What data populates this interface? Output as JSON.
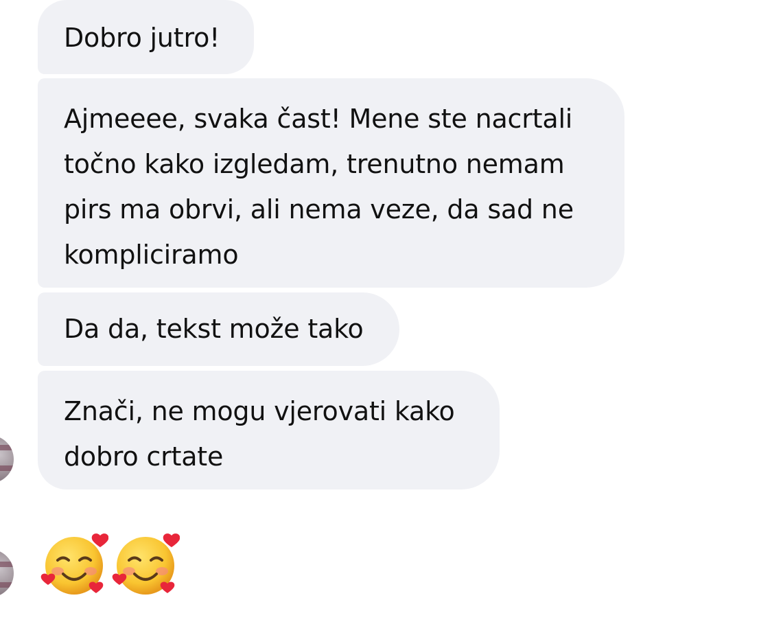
{
  "messages": [
    {
      "lines": [
        "Dobro jutro!"
      ]
    },
    {
      "lines": [
        "Ajmeeee, svaka čast! Mene ste nacrtali",
        "točno kako izgledam, trenutno nemam",
        "pirs ma obrvi, ali nema veze, da sad ne",
        "kompliciramo"
      ]
    },
    {
      "lines": [
        "Da da, tekst može tako"
      ]
    },
    {
      "lines": [
        "Znači, ne mogu vjerovati kako",
        "dobro crtate"
      ]
    }
  ],
  "reaction": {
    "emoji": "smiling-face-with-hearts",
    "count": 2
  },
  "colors": {
    "bubble_bg": "#f0f1f5",
    "text": "#111111",
    "background": "#ffffff"
  }
}
